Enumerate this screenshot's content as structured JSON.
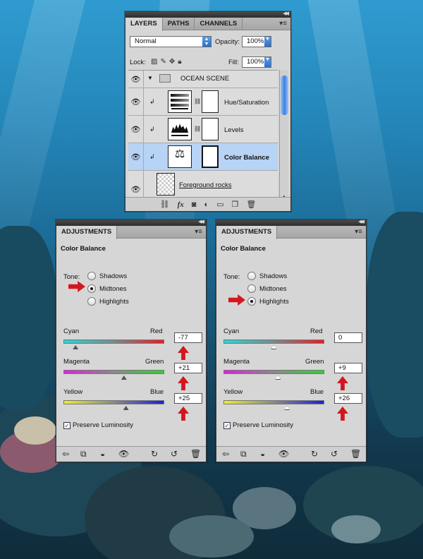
{
  "layers_panel": {
    "tabs": [
      "LAYERS",
      "PATHS",
      "CHANNELS"
    ],
    "blend_mode": "Normal",
    "opacity_label": "Opacity:",
    "opacity_value": "100%",
    "lock_label": "Lock:",
    "fill_label": "Fill:",
    "fill_value": "100%",
    "layers": [
      {
        "name": "OCEAN SCENE"
      },
      {
        "name": "Hue/Saturation"
      },
      {
        "name": "Levels"
      },
      {
        "name": "Color Balance",
        "selected": true
      },
      {
        "name": "Foreground rocks"
      }
    ]
  },
  "adjustments_left": {
    "tab": "ADJUSTMENTS",
    "title": "Color Balance",
    "tone_label": "Tone:",
    "tones": [
      "Shadows",
      "Midtones",
      "Highlights"
    ],
    "selected_tone": "Midtones",
    "sliders": [
      {
        "left": "Cyan",
        "right": "Red",
        "value": "-77",
        "fraction": 0.12
      },
      {
        "left": "Magenta",
        "right": "Green",
        "value": "+21",
        "fraction": 0.6
      },
      {
        "left": "Yellow",
        "right": "Blue",
        "value": "+25",
        "fraction": 0.62
      }
    ],
    "preserve_luminosity": "Preserve Luminosity"
  },
  "adjustments_right": {
    "tab": "ADJUSTMENTS",
    "title": "Color Balance",
    "tone_label": "Tone:",
    "tones": [
      "Shadows",
      "Midtones",
      "Highlights"
    ],
    "selected_tone": "Highlights",
    "sliders": [
      {
        "left": "Cyan",
        "right": "Red",
        "value": "0",
        "fraction": 0.5
      },
      {
        "left": "Magenta",
        "right": "Green",
        "value": "+9",
        "fraction": 0.54
      },
      {
        "left": "Yellow",
        "right": "Blue",
        "value": "+26",
        "fraction": 0.63
      }
    ],
    "preserve_luminosity": "Preserve Luminosity"
  },
  "colors": {
    "arrow": "#d3171f",
    "selection": "#b7d3f5",
    "panel": "#d6d6d6"
  },
  "icons": {
    "visibility": "eye-icon",
    "folder": "folder-icon",
    "link": "chain-icon",
    "clip": "clip-arrow-icon",
    "fx": "fx-icon",
    "trash": "trash-icon"
  }
}
